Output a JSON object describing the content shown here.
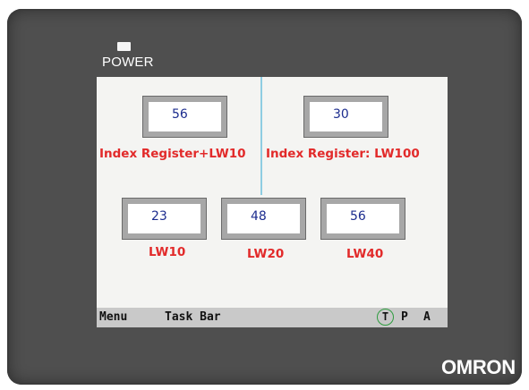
{
  "device": {
    "power_label": "POWER",
    "brand": "OMRON"
  },
  "screen": {
    "registers": [
      {
        "value": "56",
        "label": "Index Register+LW10"
      },
      {
        "value": "30",
        "label": "Index Register: LW100"
      },
      {
        "value": "23",
        "label": "LW10"
      },
      {
        "value": "48",
        "label": "LW20"
      },
      {
        "value": "56",
        "label": "LW40"
      }
    ]
  },
  "taskbar": {
    "menu_label": "Menu",
    "taskbar_label": "Task Bar",
    "t_label": "T",
    "p_label": "P",
    "a_label": "A"
  },
  "colors": {
    "label_red": "#e22a2a",
    "value_blue": "#1c2c8e",
    "bezel": "#4f4f4f",
    "screen_bg": "#f4f4f2",
    "t_ring_green": "#2e9c3e"
  }
}
